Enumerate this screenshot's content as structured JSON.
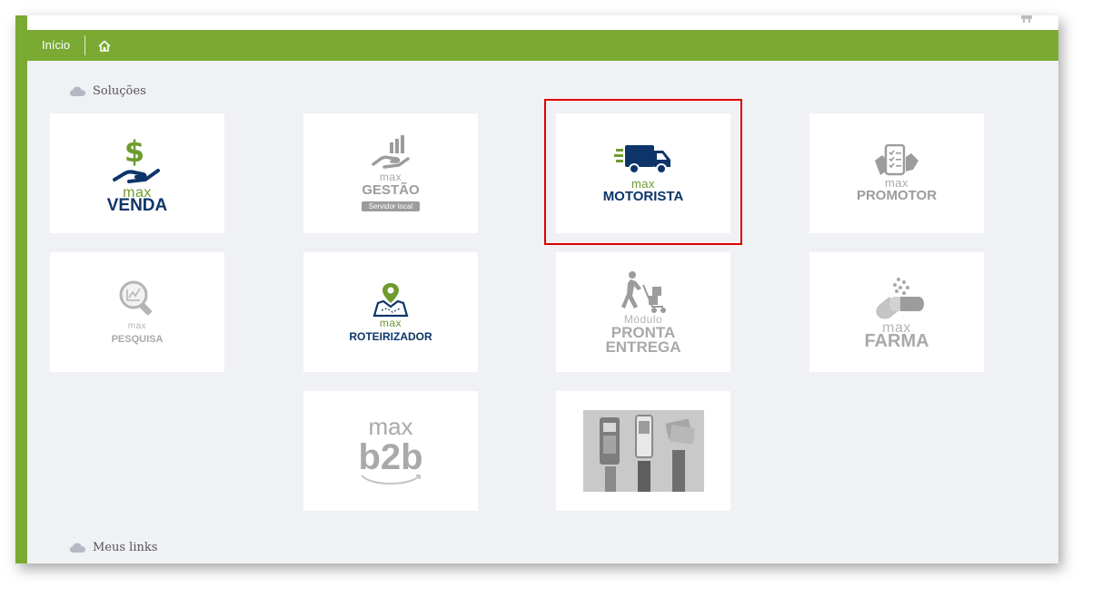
{
  "nav": {
    "home_label": "Início"
  },
  "sections": {
    "solutions_title": "Soluções",
    "links_title": "Meus links"
  },
  "cards": {
    "venda": {
      "max": "max",
      "name": "VENDA"
    },
    "gestao": {
      "max": "max",
      "name": "GESTÃO",
      "badge": "Servidor local"
    },
    "motorista": {
      "max": "max",
      "name": "MOTORISTA"
    },
    "promotor": {
      "max": "max",
      "name": "PROMOTOR"
    },
    "pesquisa": {
      "max": "max",
      "name": "PESQUISA"
    },
    "roteirizador": {
      "max": "max",
      "name": "ROTEIRIZADOR"
    },
    "pronta": {
      "modulo": "Módulo",
      "name1": "PRONTA",
      "name2": "ENTREGA"
    },
    "farma": {
      "max": "max",
      "name": "FARMA"
    },
    "b2b": {
      "max": "max",
      "name": "b2b"
    }
  },
  "colors": {
    "green": "#7aaa32",
    "navy": "#0d3569",
    "grey_logo": "#a9a9a9",
    "highlight": "#e00000"
  }
}
